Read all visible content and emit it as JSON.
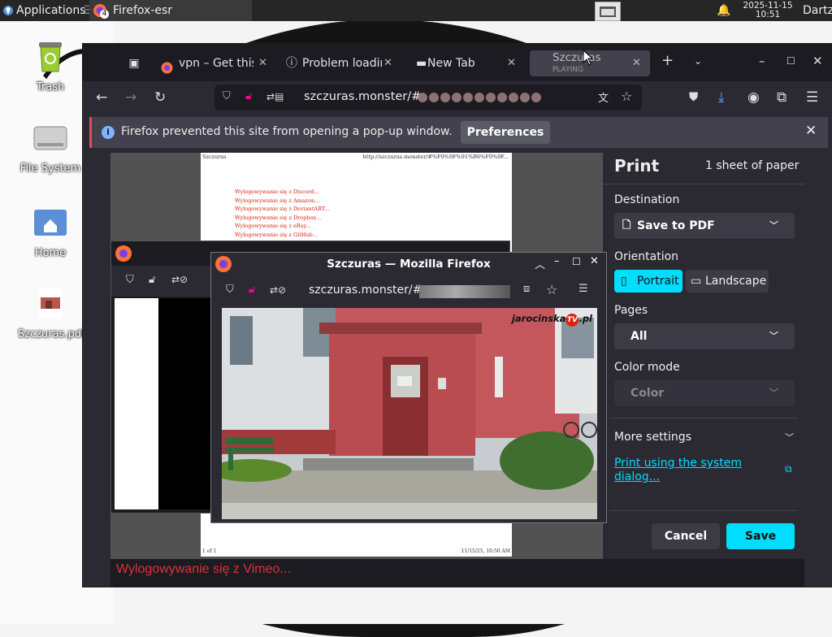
{
  "panel": {
    "applications": "Applications",
    "task_badge": "4",
    "task_title": "Firefox-esr",
    "date": "2025-11-15",
    "time": "10:51",
    "user": "Dartz"
  },
  "desktop": {
    "icons": [
      "Trash",
      "File System",
      "Home",
      "Szczuras.pdf"
    ]
  },
  "browser": {
    "tabs": [
      {
        "label": "vpn – Get this"
      },
      {
        "label": "Problem loadin"
      },
      {
        "label": "New Tab"
      },
      {
        "label": "Szczuras",
        "sub": "PLAYING"
      }
    ],
    "url_host": "szczuras.monster/#",
    "notification": "Firefox prevented this site from opening a pop-up window.",
    "preferences_label": "Preferences"
  },
  "print": {
    "title": "Print",
    "sheets": "1 sheet of paper",
    "destination_label": "Destination",
    "destination_value": "Save to PDF",
    "orientation_label": "Orientation",
    "portrait": "Portrait",
    "landscape": "Landscape",
    "pages_label": "Pages",
    "pages_value": "All",
    "color_label": "Color mode",
    "color_value": "Color",
    "more_settings": "More settings",
    "system_dialog": "Print using the system dialog...",
    "cancel": "Cancel",
    "save": "Save"
  },
  "preview": {
    "header_left": "Szczuras",
    "header_right": "http://szczuras.monster/#%F0%9F%91%B6%F0%9F...",
    "links": [
      "Wylogowywanie się z Discord...",
      "Wylogowywanie się z Amazon...",
      "Wylogowywanie się z DeviantART...",
      "Wylogowywanie się z Dropbox...",
      "Wylogowywanie się z eBay...",
      "Wylogowywanie się z GitHub..."
    ],
    "footer_left": "1 of 1",
    "footer_right": "11/15/25, 10:50 AM"
  },
  "below_text": "Wylogowywanie się z Vimeo...",
  "popup": {
    "title": "Szczuras — Mozilla Firefox",
    "url_host": "szczuras.monster/#",
    "watermark": "jarocinska",
    "watermark_tv": "TV",
    "watermark_suffix": ".pl"
  }
}
